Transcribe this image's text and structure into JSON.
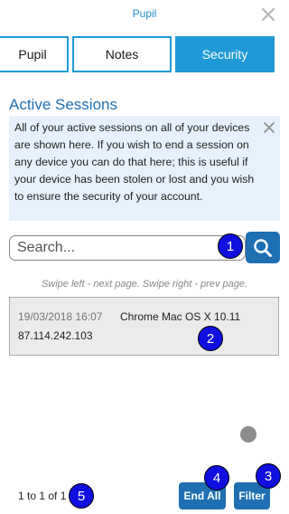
{
  "header": {
    "title": "Pupil"
  },
  "tabs": [
    {
      "label": "Pupil"
    },
    {
      "label": "Notes"
    },
    {
      "label": "Security"
    }
  ],
  "section": {
    "title": "Active Sessions",
    "info_text": "All of your active sessions on all of your devices are shown here. If you wish to end a session on any device you can do that here; this is useful if your device has been stolen or lost and you wish to ensure the security of your account."
  },
  "search": {
    "placeholder": "Search..."
  },
  "swipe_hint": "Swipe left - next page. Swipe right - prev page.",
  "sessions": [
    {
      "datetime": "19/03/2018 16:07",
      "browser": "Chrome Mac OS X 10.11",
      "ip": "87.114.242.103"
    }
  ],
  "pager": {
    "text": "1 to 1 of 1"
  },
  "buttons": {
    "end_all": "End All",
    "filter": "Filter"
  },
  "markers": [
    "1",
    "2",
    "3",
    "4",
    "5"
  ],
  "colors": {
    "accent": "#1f9ad6",
    "primary": "#1f6fb3",
    "info_bg": "#e6f1fb",
    "marker": "#0f0fe0"
  }
}
